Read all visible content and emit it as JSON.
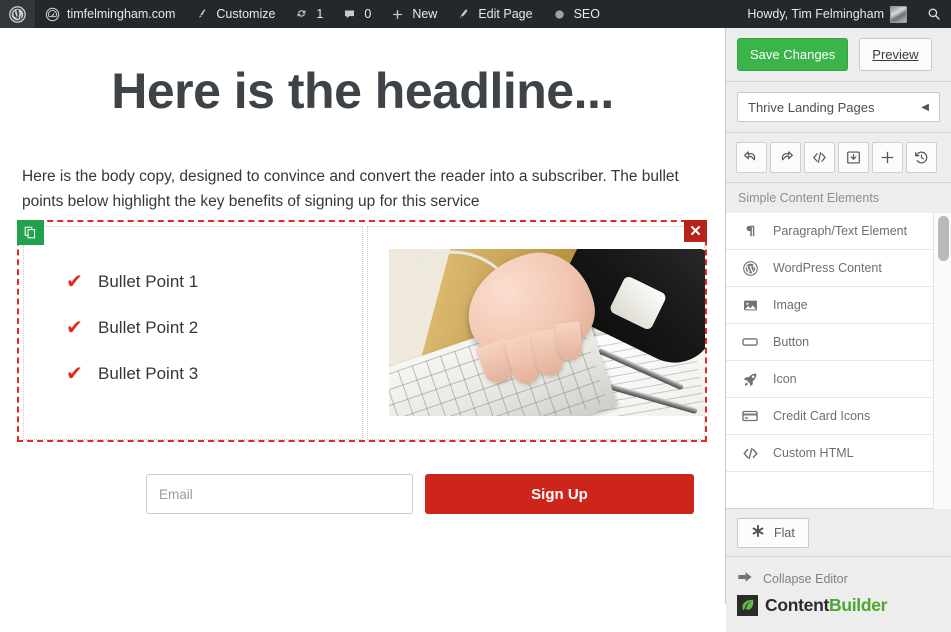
{
  "adminbar": {
    "wp_logo": "wordpress-logo-icon",
    "site_name": "timfelmingham.com",
    "customize": "Customize",
    "updates_count": "1",
    "comments_count": "0",
    "new": "New",
    "edit_page": "Edit Page",
    "seo": "SEO",
    "howdy": "Howdy, Tim Felmingham",
    "search": "search-icon"
  },
  "canvas": {
    "headline": "Here is the headline...",
    "body_copy": "Here is the body copy, designed to convince and convert the reader into a subscriber. The bullet points below highlight the key benefits of signing up for this service",
    "bullets": [
      {
        "check": "✔",
        "label": "Bullet Point 1"
      },
      {
        "check": "✔",
        "label": "Bullet Point 2"
      },
      {
        "check": "✔",
        "label": "Bullet Point 3"
      }
    ],
    "selection": {
      "clone_icon": "duplicate-icon",
      "delete_icon": "✕",
      "border_color": "#e02b20",
      "clone_color": "#22a24c",
      "delete_color": "#b7231b"
    },
    "image_alt": "hand reaching over a white keyboard with documents and pens on a desk",
    "form": {
      "email_placeholder": "Email",
      "email_value": "",
      "submit_label": "Sign Up",
      "submit_color": "#cd241c"
    }
  },
  "panel": {
    "save_label": "Save Changes",
    "save_color": "#3bb54a",
    "preview_label": "Preview",
    "template_select": "Thrive Landing Pages",
    "template_caret": "◀",
    "tools": [
      {
        "name": "undo-icon",
        "title": "Undo"
      },
      {
        "name": "redo-icon",
        "title": "Redo"
      },
      {
        "name": "code-icon",
        "title": "Code"
      },
      {
        "name": "save-template-icon",
        "title": "Save Template"
      },
      {
        "name": "plus-icon",
        "title": "Add"
      },
      {
        "name": "history-icon",
        "title": "Revision History"
      }
    ],
    "list_header": "Simple Content Elements",
    "elements": [
      {
        "icon": "paragraph-icon",
        "label": "Paragraph/Text Element"
      },
      {
        "icon": "wordpress-icon",
        "label": "WordPress Content"
      },
      {
        "icon": "image-icon",
        "label": "Image"
      },
      {
        "icon": "button-icon",
        "label": "Button"
      },
      {
        "icon": "rocket-icon",
        "label": "Icon"
      },
      {
        "icon": "credit-card-icon",
        "label": "Credit Card Icons"
      },
      {
        "icon": "code-brackets-icon",
        "label": "Custom HTML"
      }
    ],
    "style_button": {
      "icon": "asterisk-icon",
      "label": "Flat"
    },
    "collapse_label": "Collapse Editor",
    "brand": {
      "first": "Content",
      "second": "Builder",
      "accent": "#4aa832"
    }
  }
}
